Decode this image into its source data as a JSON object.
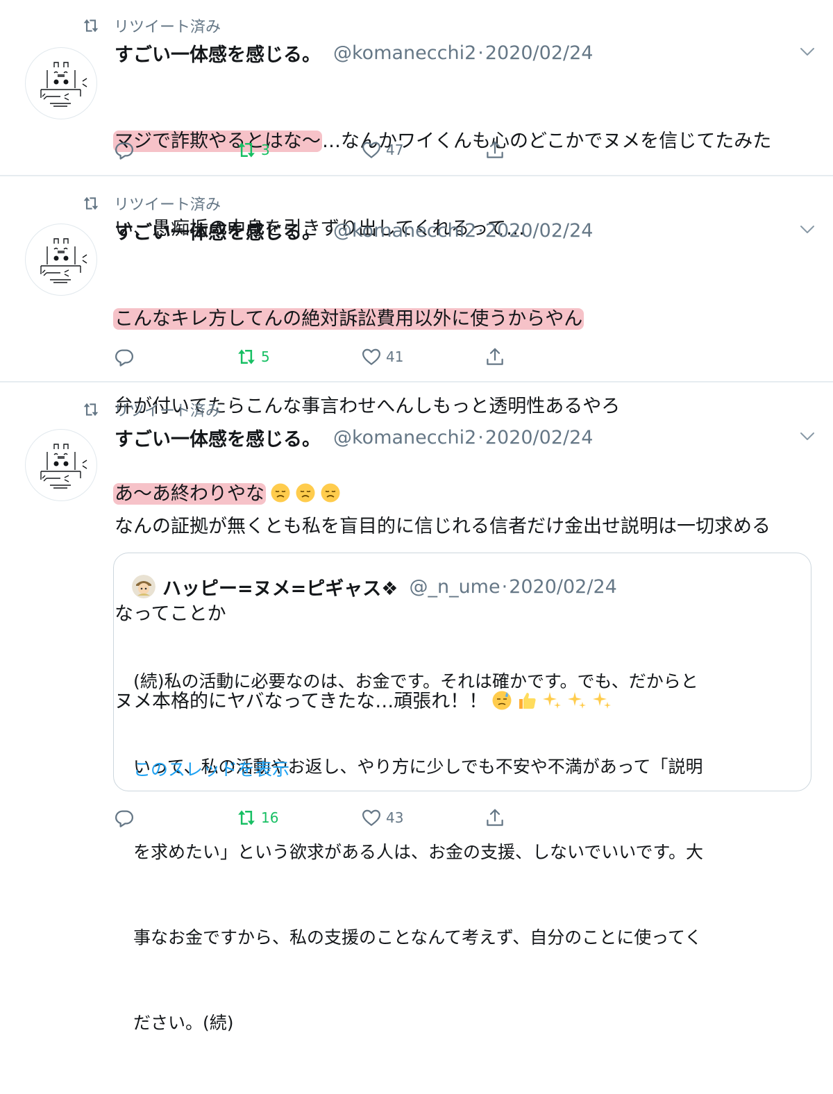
{
  "colors": {
    "retweet_green": "#17bf63",
    "secondary_gray": "#657786",
    "highlight_pink": "#ec7884",
    "link_blue": "#1da1f2"
  },
  "tweets": [
    {
      "retweeted_label": "リツイート済み",
      "name": "すごい一体感を感じる。",
      "handle": "@komanecchi2",
      "sep": "·",
      "date": "2020/02/24",
      "lines": [
        {
          "hl": "マジで詐欺やるとはな〜",
          "rest": "…なんかワイくんも心のどこかでヌメを信じてたみた"
        },
        {
          "hl": "",
          "rest": "い、愚痴垢の中身を引きずり出してくれるって…"
        }
      ],
      "retweets": "3",
      "likes": "47"
    },
    {
      "retweeted_label": "リツイート済み",
      "name": "すごい一体感を感じる。",
      "handle": "@komanecchi2",
      "sep": "·",
      "date": "2020/02/24",
      "lines": [
        {
          "hl": "こんなキレ方してんの絶対訴訟費用以外に使うからやん",
          "rest": ""
        },
        {
          "hl": "",
          "rest": "弁が付いてたらこんな事言わせへんしもっと透明性あるやろ"
        },
        {
          "hl": "あ〜あ終わりやな",
          "rest": ""
        }
      ],
      "emojis": [
        "disappointed-face-emoji",
        "disappointed-face-emoji",
        "disappointed-face-emoji"
      ],
      "retweets": "5",
      "likes": "41"
    },
    {
      "retweeted_label": "リツイート済み",
      "name": "すごい一体感を感じる。",
      "handle": "@komanecchi2",
      "sep": "·",
      "date": "2020/02/24",
      "lines": [
        {
          "hl": "",
          "rest": "なんの証拠が無くとも私を盲目的に信じれる信者だけ金出せ説明は一切求める"
        },
        {
          "hl": "",
          "rest": "なってことか"
        },
        {
          "hl": "",
          "rest": "ヌメ本格的にヤバなってきたな…頑張れ！！"
        }
      ],
      "emojis": [
        "downcast-sweat-face-emoji",
        "thumbs-up-emoji",
        "sparkles-emoji",
        "sparkles-emoji",
        "sparkles-emoji"
      ],
      "quote": {
        "name": "ハッピー=ヌメ=ピギャス❖",
        "handle": "@_n_ume",
        "sep": "·",
        "date": "2020/02/24",
        "lines": [
          "(続)私の活動に必要なのは、お金です。それは確かです。でも、だからと",
          "いって、私の活動やお返し、やり方に少しでも不安や不満があって「説明",
          "を求めたい」という欲求がある人は、お金の支援、しないでいいです。大",
          "事なお金ですから、私の支援のことなんて考えず、自分のことに使ってく",
          "ださい。(続)"
        ],
        "show_thread": "このスレッドを表示"
      },
      "retweets": "16",
      "likes": "43"
    }
  ]
}
